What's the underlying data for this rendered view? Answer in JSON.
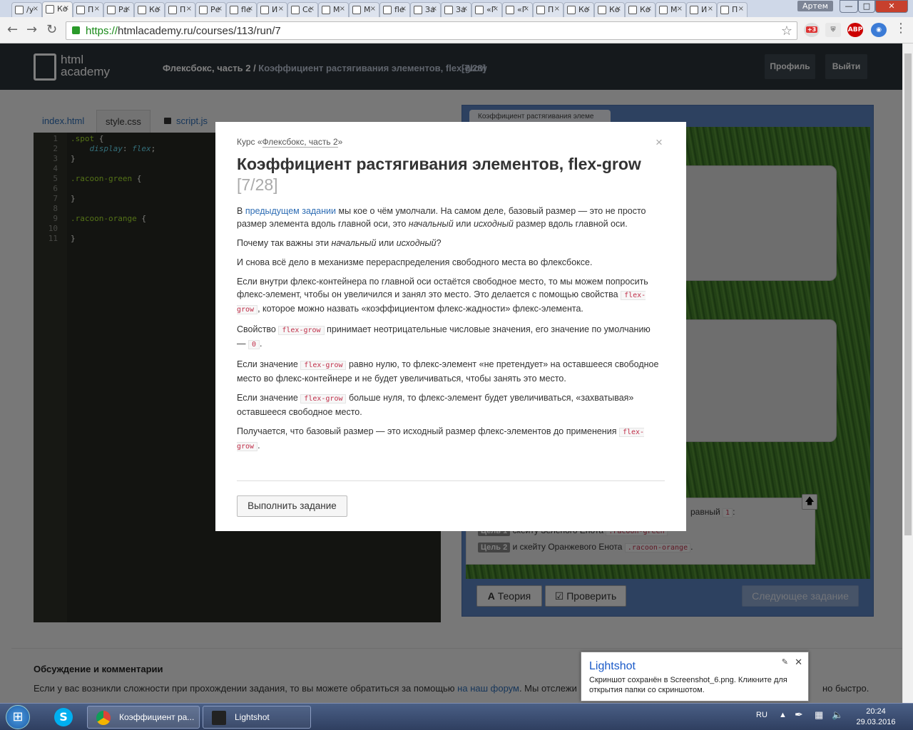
{
  "browser": {
    "tabs": [
      "/у",
      "Ко",
      "П",
      "Ра",
      "Ко",
      "П",
      "Ре",
      "fle",
      "И",
      "Сс",
      "М",
      "М",
      "fle",
      "За",
      "За",
      "«Г",
      "«Г",
      "П",
      "Ко",
      "Ко",
      "Ко",
      "М",
      "И",
      "П"
    ],
    "user_badge": "Артем",
    "url_scheme": "https://",
    "url_rest": "htmlacademy.ru/courses/113/run/7",
    "ext_badge": "+3",
    "abp_label": "ABP"
  },
  "header": {
    "logo_line1": "html",
    "logo_line2": "academy",
    "crumb_part": "Флексбокс, часть 2",
    "crumb_sep": " / ",
    "crumb_lesson": "Коэффициент растягивания элементов, flex-grow",
    "counter": "[7/28]",
    "profile_btn": "Профиль",
    "logout_btn": "Выйти"
  },
  "files": {
    "index": "index.html",
    "style": "style.css",
    "script": "script.js"
  },
  "editor": {
    "line_numbers": [
      "1",
      "2",
      "3",
      "4",
      "5",
      "6",
      "7",
      "8",
      "9",
      "10",
      "11"
    ]
  },
  "preview": {
    "tab_label": "Коэффициент растягивания элеме",
    "task_line1_end": "равный",
    "task_line1_val": "1",
    "goal1_label": "Цель 1",
    "goal1_text": "скейту Зеленого Енота",
    "goal1_code": ".racoon-green",
    "goal2_label": "Цель 2",
    "goal2_text": "и скейту Оранжевого Енота",
    "goal2_code": ".racoon-orange",
    "theory_btn": "Теория",
    "check_btn": "Проверить",
    "next_btn": "Следующее задание"
  },
  "footer": {
    "title": "Обсуждение и комментарии",
    "text_before": "Если у вас возникли сложности при прохождении задания, то вы можете обратиться за помощью",
    "link": "на наш форум",
    "text_after": ". Мы отслежи",
    "text_tail": "но быстро."
  },
  "modal": {
    "course_prefix": "Курс «",
    "course_name": "Флексбокс, часть 2",
    "course_suffix": "»",
    "close": "×",
    "title": "Коэффициент растягивания элементов, flex-grow",
    "title_counter": "[7/28]",
    "p1_a": "В",
    "p1_link": "предыдущем задании",
    "p1_b": "мы кое о чём умолчали. На самом деле, базовый размер — это не просто размер элемента вдоль главной оси, это",
    "p1_em1": "начальный",
    "p1_c": "или",
    "p1_em2": "исходный",
    "p1_d": "размер вдоль главной оси.",
    "p2_a": "Почему так важны эти",
    "p2_em1": "начальный",
    "p2_b": "или",
    "p2_em2": "исходный",
    "p2_c": "?",
    "p3": "И снова всё дело в механизме перераспределения свободного места во флексбоксе.",
    "p4_a": "Если внутри флекс-контейнера по главной оси остаётся свободное место, то мы можем попросить флекс-элемент, чтобы он увеличился и занял это место. Это делается с помощью свойства",
    "p4_code": "flex-grow",
    "p4_b": ", которое можно назвать «коэффициентом флекс-жадности» флекс-элемента.",
    "p5_a": "Свойство",
    "p5_code": "flex-grow",
    "p5_b": "принимает неотрицательные числовые значения, его значение по умолчанию —",
    "p5_code2": "0",
    "p5_c": ".",
    "p6_a": "Если значение",
    "p6_code": "flex-grow",
    "p6_b": "равно нулю, то флекс-элемент «не претендует» на оставшееся свободное место во флекс-контейнере и не будет увеличиваться, чтобы занять это место.",
    "p7_a": "Если значение",
    "p7_code": "flex-grow",
    "p7_b": "больше нуля, то флекс-элемент будет увеличиваться, «захватывая» оставшееся свободное место.",
    "p8_a": "Получается, что базовый размер — это исходный размер флекс-элементов до применения",
    "p8_code": "flex-grow",
    "p8_b": ".",
    "action_btn": "Выполнить задание"
  },
  "lightshot": {
    "title": "Lightshot",
    "message": "Скриншот сохранён в Screenshot_6.png. Кликните для открытия папки со скриншотом."
  },
  "taskbar": {
    "chrome_item": "Коэффициент ра...",
    "lightshot_item": "Lightshot",
    "lang": "RU",
    "time": "20:24",
    "date": "29.03.2016"
  }
}
